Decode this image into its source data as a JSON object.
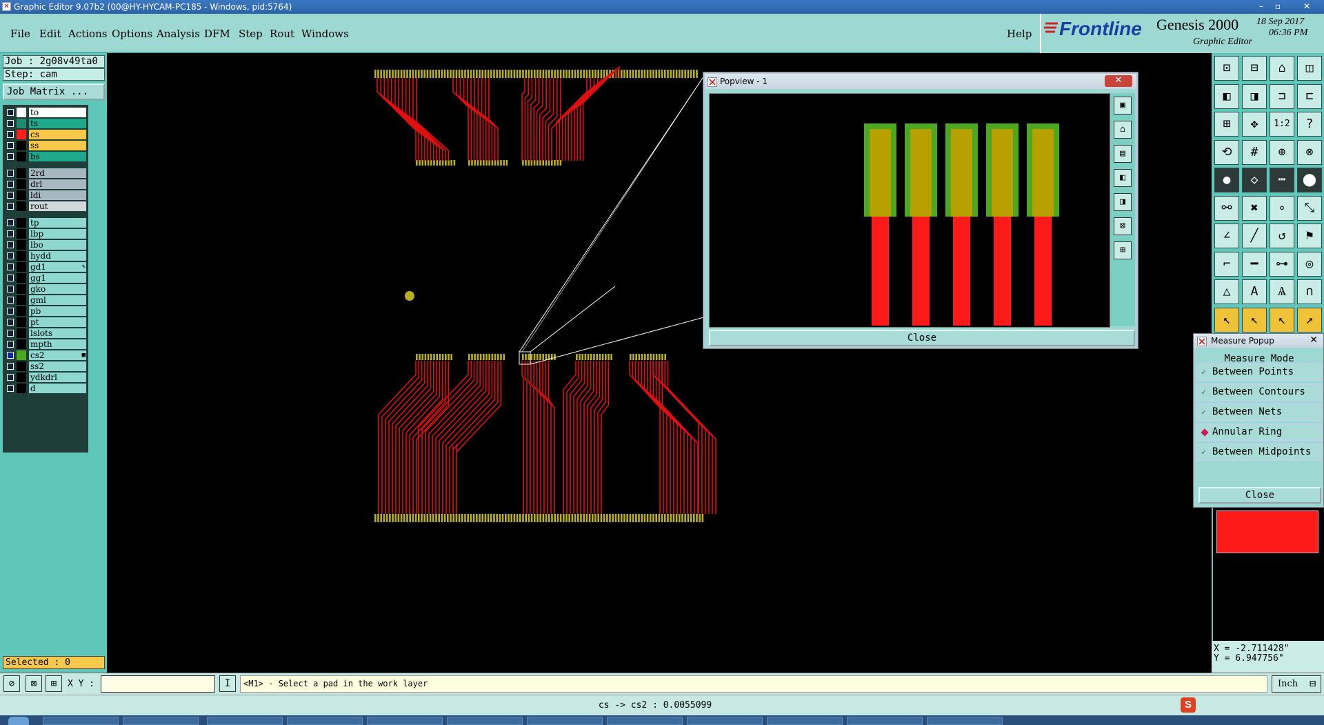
{
  "window": {
    "title": "Graphic Editor 9.07b2 (00@HY-HYCAM-PC185 - Windows, pid:5764)",
    "controls": [
      "–",
      "▫",
      "✕"
    ]
  },
  "menu": {
    "items": [
      "File",
      "Edit",
      "Actions",
      "Options",
      "Analysis",
      "DFM",
      "Step",
      "Rout",
      "Windows"
    ],
    "help": "Help"
  },
  "brand": {
    "logo": "Frontline",
    "product": "Genesis 2000",
    "subtitle": "Graphic Editor",
    "date": "18 Sep 2017",
    "time": "06:36 PM"
  },
  "left_panel": {
    "job": "Job : 2g08v49ta0",
    "step": "Step: cam",
    "job_matrix_button": "Job Matrix ...",
    "layers": [
      {
        "name": "to",
        "color": "#ffffff",
        "bg": "#ffffff",
        "checked": false
      },
      {
        "name": "ts",
        "color": "#1f8a6e",
        "bg": "#1fa88a",
        "checked": false
      },
      {
        "name": "cs",
        "color": "#ff2020",
        "bg": "#f7c84a",
        "checked": false
      },
      {
        "name": "ss",
        "color": "#000000",
        "bg": "#f7c84a",
        "checked": false
      },
      {
        "name": "bs",
        "color": "#000000",
        "bg": "#1fa88a",
        "checked": false
      },
      {
        "name": "2rd",
        "color": "#000000",
        "bg": "#a8b8c0",
        "checked": false
      },
      {
        "name": "drl",
        "color": "#000000",
        "bg": "#a8b8c0",
        "checked": false
      },
      {
        "name": "ldi",
        "color": "#000000",
        "bg": "#a8b8c0",
        "checked": false
      },
      {
        "name": "rout",
        "color": "#000000",
        "bg": "#d0d8d8",
        "checked": false
      },
      {
        "name": "tp",
        "color": "#000000",
        "bg": "#8ed8d0",
        "checked": false
      },
      {
        "name": "lbp",
        "color": "#000000",
        "bg": "#8ed8d0",
        "checked": false
      },
      {
        "name": "lbo",
        "color": "#000000",
        "bg": "#8ed8d0",
        "checked": false
      },
      {
        "name": "hydd",
        "color": "#000000",
        "bg": "#8ed8d0",
        "checked": false
      },
      {
        "name": "gd1",
        "color": "#000000",
        "bg": "#8ed8d0",
        "checked": false,
        "mark": "✎"
      },
      {
        "name": "gg1",
        "color": "#000000",
        "bg": "#8ed8d0",
        "checked": false
      },
      {
        "name": "gko",
        "color": "#000000",
        "bg": "#8ed8d0",
        "checked": false
      },
      {
        "name": "gml",
        "color": "#000000",
        "bg": "#8ed8d0",
        "checked": false
      },
      {
        "name": "pb",
        "color": "#000000",
        "bg": "#8ed8d0",
        "checked": false
      },
      {
        "name": "pt",
        "color": "#000000",
        "bg": "#8ed8d0",
        "checked": false
      },
      {
        "name": "lslots",
        "color": "#000000",
        "bg": "#8ed8d0",
        "checked": false
      },
      {
        "name": "mpth",
        "color": "#000000",
        "bg": "#8ed8d0",
        "checked": false
      },
      {
        "name": "cs2",
        "color": "#4ca820",
        "bg": "#8ed8d0",
        "checked": true,
        "mark": "■"
      },
      {
        "name": "ss2",
        "color": "#000000",
        "bg": "#8ed8d0",
        "checked": false
      },
      {
        "name": "ydkdrl",
        "color": "#000000",
        "bg": "#8ed8d0",
        "checked": false
      },
      {
        "name": "d",
        "color": "#000000",
        "bg": "#8ed8d0",
        "checked": false
      }
    ],
    "selected": "Selected : 0"
  },
  "popview": {
    "title": "Popview - 1",
    "close_x": "✕",
    "close_button": "Close",
    "tool_icons": [
      "zoom-fit-icon",
      "zoom-home-icon",
      "zoom-in-icon",
      "zoom-out-icon",
      "pan-icon",
      "zoom-extents-icon",
      "zoom-window-icon"
    ]
  },
  "right_toolbar": {
    "rows": [
      [
        "zoom-home-icon",
        "zoom-save-icon",
        "house-icon",
        "window-icon"
      ],
      [
        "zoom-left-icon",
        "zoom-right-icon",
        "zoom-back-icon",
        "zoom-forward-icon"
      ],
      [
        "fit-screen-icon",
        "pan-center-icon",
        "scale-1-2-icon",
        "help-icon"
      ],
      [
        "redraw-icon",
        "grid-icon",
        "snap-icon",
        "snap-settings-icon"
      ],
      [
        "select-pad-icon",
        "select-outline-icon",
        "dashed-line-icon",
        "dot-icon"
      ],
      [
        "connect-nodes-icon",
        "delete-node-icon",
        "node-edit-icon",
        "node-move-icon"
      ],
      [
        "line-red-icon",
        "line-blue-icon",
        "arc-icon",
        "flag-icon"
      ],
      [
        "measure-corner-icon",
        "measure-line-icon",
        "measure-dims-icon",
        "measure-shapes-icon"
      ],
      [
        "triangle-red-icon",
        "triangle-a-icon",
        "arch-a-icon",
        "arch-red-icon"
      ],
      [
        "cursor-icon",
        "cursor-red-icon",
        "cursor-blue-icon",
        "cursor-path-icon"
      ]
    ]
  },
  "measure_popup": {
    "title": "Measure Popup",
    "close_x": "✕",
    "mode_label": "Measure Mode",
    "options": [
      {
        "label": "Between Points",
        "selected": false
      },
      {
        "label": "Between Contours",
        "selected": false
      },
      {
        "label": "Between Nets",
        "selected": false
      },
      {
        "label": "Annular Ring",
        "selected": true
      },
      {
        "label": "Between Midpoints",
        "selected": false
      }
    ],
    "close_button": "Close"
  },
  "coords": {
    "x": "X = -2.711428\"",
    "y": "Y = 6.947756\""
  },
  "command_bar": {
    "xy_label": "X Y :",
    "xy_value": "",
    "prompt": "<M1> - Select a pad in the work layer",
    "unit": "Inch"
  },
  "info_bar": {
    "text": "cs -> cs2 : 0.0055099"
  },
  "colors": {
    "trace": "#e01010",
    "pad": "#b8b020",
    "pad_green": "#4ca820",
    "pad_gold": "#b8a000",
    "panel": "#5ec7b9",
    "menu_bg": "#9ed8d2"
  }
}
